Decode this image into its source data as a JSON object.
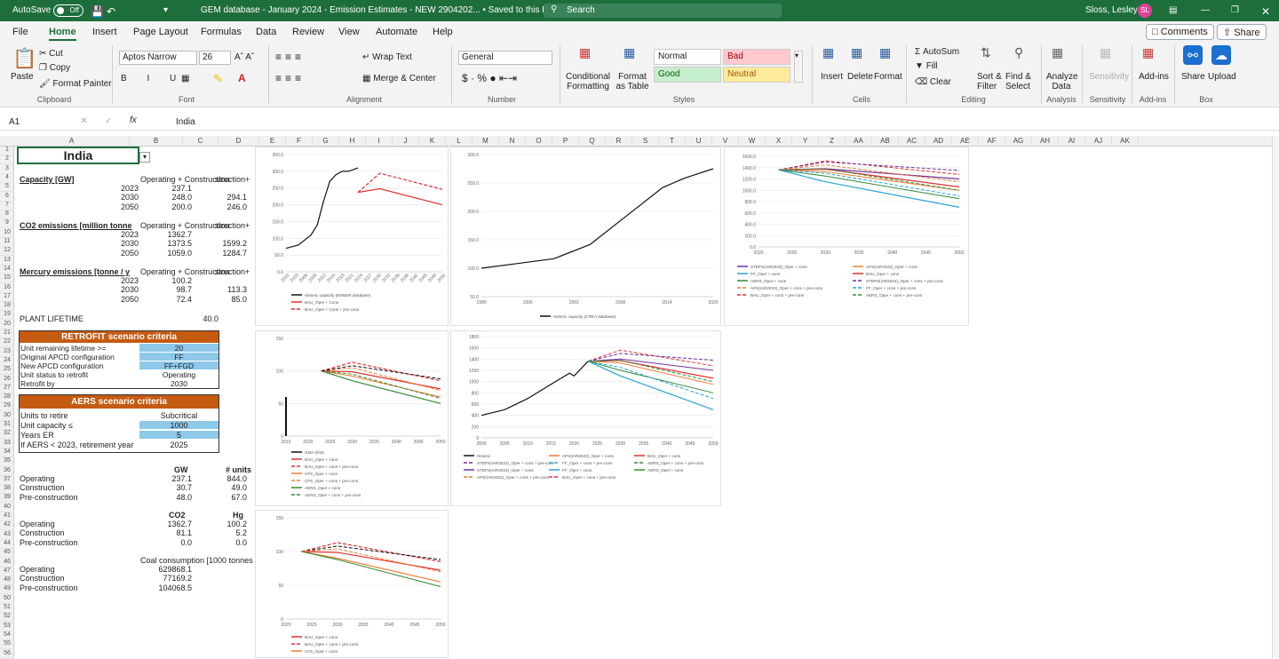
{
  "titlebar": {
    "autosave": "AutoSave",
    "autosave_state": "Off",
    "doc_title": "GEM database - January 2024 - Emission Estimates - NEW 2904202... • Saved to this PC ∨",
    "search": "Search",
    "user": "Sloss, Lesley",
    "user_initials": "SL"
  },
  "menu": {
    "tabs": [
      "File",
      "Home",
      "Insert",
      "Page Layout",
      "Formulas",
      "Data",
      "Review",
      "View",
      "Automate",
      "Help"
    ],
    "comments": "Comments",
    "share": "Share"
  },
  "ribbon": {
    "paste": "Paste",
    "cut": "Cut",
    "copy": "Copy",
    "format_painter": "Format Painter",
    "clipboard": "Clipboard",
    "font_name": "Aptos Narrow",
    "font_size": "26",
    "font_group": "Font",
    "wrap_text": "Wrap Text",
    "merge_center": "Merge & Center",
    "alignment": "Alignment",
    "number_format": "General",
    "number": "Number",
    "conditional_formatting": "Conditional Formatting",
    "format_as_table": "Format as Table",
    "style_normal": "Normal",
    "style_bad": "Bad",
    "style_good": "Good",
    "style_neutral": "Neutral",
    "styles": "Styles",
    "insert": "Insert",
    "delete": "Delete",
    "format": "Format",
    "cells": "Cells",
    "autosum": "AutoSum",
    "fill": "Fill",
    "clear": "Clear",
    "sort_filter": "Sort & Filter",
    "find_select": "Find & Select",
    "editing": "Editing",
    "analyze_data": "Analyze Data",
    "analysis": "Analysis",
    "sensitivity": "Sensitivity",
    "sensitivity_group": "Sensitivity",
    "addins": "Add-ins",
    "addins_group": "Add-ins",
    "share": "Share",
    "upload": "Upload",
    "box": "Box"
  },
  "formula_bar": {
    "name_box": "A1",
    "formula": "India"
  },
  "columns": [
    "A",
    "B",
    "C",
    "D",
    "E",
    "F",
    "G",
    "H",
    "I",
    "J",
    "K",
    "L",
    "M",
    "N",
    "O",
    "P",
    "Q",
    "R",
    "S",
    "T",
    "U",
    "V",
    "W",
    "X",
    "Y",
    "Z",
    "AA",
    "AB",
    "AC",
    "AD",
    "AE",
    "AF",
    "AG",
    "AH",
    "AI",
    "AJ",
    "AK"
  ],
  "sheet": {
    "country": "India",
    "capacity_title": "Capacity [GW]",
    "co2_title": "CO2 emissions [million tonne",
    "hg_title": "Mercury emissions [tonne / y",
    "col_op_con": "Operating + Construction",
    "col_struction": "struction+",
    "col_op_con_pre": "Operating + Construction + Pre-construction",
    "capacity_rows": [
      [
        "2023",
        "237.1",
        ""
      ],
      [
        "2030",
        "248.0",
        "294.1"
      ],
      [
        "2050",
        "200.0",
        "246.0"
      ]
    ],
    "co2_rows": [
      [
        "2023",
        "1362.7",
        ""
      ],
      [
        "2030",
        "1373.5",
        "1599.2"
      ],
      [
        "2050",
        "1059.0",
        "1284.7"
      ]
    ],
    "hg_rows": [
      [
        "2023",
        "100.2",
        ""
      ],
      [
        "2030",
        "98.7",
        "113.3"
      ],
      [
        "2050",
        "72.4",
        "85.0"
      ]
    ],
    "plant_lifetime_label": "PLANT LIFETIME",
    "plant_lifetime": "40.0",
    "retrofit_title": "RETROFIT scenario criteria",
    "retrofit_rows": [
      [
        "Unit remaining lifetime >=",
        "20"
      ],
      [
        "Original APCD configuration",
        "FF"
      ],
      [
        "New APCD configuration",
        "FF+FGD"
      ],
      [
        "Unit status to retrofit",
        "Operating"
      ],
      [
        "Retrofit by",
        "2030"
      ]
    ],
    "aers_title": "AERS scenario criteria",
    "aers_rows": [
      [
        "Units to retire",
        "Subcritical"
      ],
      [
        "Unit capacity ≤",
        "1000"
      ],
      [
        "Years ER",
        "5"
      ],
      [
        "If AERS < 2023, retirement year",
        "2025"
      ]
    ],
    "gw_header": "GW",
    "units_header": "# units",
    "gw_rows": [
      [
        "Operating",
        "237.1",
        "844.0"
      ],
      [
        "Construction",
        "30.7",
        "49.0"
      ],
      [
        "Pre-construction",
        "48.0",
        "67.0"
      ]
    ],
    "co2_header": "CO2",
    "hg_header": "Hg",
    "co2hg_rows": [
      [
        "Operating",
        "1362.7",
        "100.2"
      ],
      [
        "Construction",
        "81.1",
        "5.2"
      ],
      [
        "Pre-construction",
        "0.0",
        "0.0"
      ]
    ],
    "coal_header": "Coal consumption [1000 tonnes / year]",
    "coal_rows": [
      [
        "Operating",
        "629868.1"
      ],
      [
        "Construction",
        "77169.2"
      ],
      [
        "Pre-construction",
        "104068.5"
      ]
    ]
  },
  "charts": {
    "c1_legend": [
      "Historic capacity (EMBER database)",
      "BAU_Oper + Cons",
      "BAU_Oper + Cons + pre-cons"
    ],
    "c2_legend": [
      "Historic capacity (CREA database)"
    ],
    "c3_legend": [
      "STEPS(IAR2023)_Oper + cons",
      "APS(IAR2023)_Oper + cons",
      "FF_Oper + cons",
      "BAU_Oper + cons",
      "AERS_Oper + cons",
      "STEPS(IAR2023)_Oper + cons + pre-cons",
      "APS(IAR2023)_Oper + cons + pre-cons",
      "FF_Oper + cons + pre-cons",
      "BAU_Oper + cons + pre-cons",
      "AERS_Oper + cons + pre-cons"
    ],
    "c4_legend": [
      "GMA 2018",
      "BAU_Oper + cons",
      "BAU_Oper + cons + pre-cons",
      "CFS_Oper + cons",
      "CFS_Oper + cons + pre-cons",
      "AERS_Oper + cons",
      "AERS_Oper + cons + pre-cons"
    ],
    "c5_legend": [
      "Historic",
      "APS(IAR2023)_Oper + cons",
      "BAU_Oper + cons",
      "STEPS(IAR2023)_Oper + cons + pre-cons",
      "FF_Oper + cons + pre-cons",
      "AERS_Oper + cons + pre-cons",
      "STEPS(IAR2023)_Oper + cons",
      "FF_Oper + cons",
      "AERS_Oper + cons",
      "APS(IAR2023)_Oper + cons + pre-cons",
      "BAU_Oper + cons + pre-cons"
    ],
    "c6_legend": [
      "BAU_Oper + cons",
      "BAU_Oper + cons + pre-cons",
      "CFS_Oper + cons"
    ]
  },
  "chart_data": [
    {
      "type": "line",
      "title": "",
      "series": [
        {
          "name": "Historic capacity (EMBER database)",
          "x": [
            2000,
            2004,
            2008,
            2010,
            2012,
            2014,
            2016,
            2018,
            2020,
            2023
          ],
          "values": [
            70,
            80,
            110,
            140,
            210,
            270,
            290,
            300,
            300,
            310
          ]
        },
        {
          "name": "BAU_Oper + Cons",
          "x": [
            2023,
            2030,
            2050
          ],
          "values": [
            237,
            248,
            200
          ]
        },
        {
          "name": "BAU_Oper + Cons + pre-cons",
          "x": [
            2023,
            2030,
            2050
          ],
          "values": [
            237,
            294,
            246
          ]
        }
      ],
      "ylim": [
        0,
        350
      ],
      "ytick_labels": [
        "0.0",
        "50.0",
        "100.0",
        "150.0",
        "200.0",
        "250.0",
        "300.0",
        "350.0"
      ],
      "xtick_labels": [
        "2000",
        "2003",
        "2006",
        "2009",
        "2012",
        "2015",
        "2018",
        "2021",
        "2024",
        "2027",
        "2030",
        "2033",
        "2036",
        "2039",
        "2042",
        "2045",
        "2048",
        "2050"
      ]
    },
    {
      "type": "line",
      "series": [
        {
          "name": "Historic capacity (CREA database)",
          "x": [
            1990,
            1995,
            2000,
            2005,
            2010,
            2015,
            2018,
            2020,
            2022
          ],
          "values": [
            60,
            70,
            80,
            110,
            170,
            230,
            250,
            260,
            270
          ]
        }
      ],
      "ylim": [
        0,
        300
      ],
      "ytick_labels": [
        "50.0",
        "100.0",
        "150.0",
        "200.0",
        "250.0",
        "300.0"
      ],
      "xtick_labels": [
        "1990",
        "1996",
        "2002",
        "2008",
        "2014",
        "2020"
      ]
    },
    {
      "type": "line",
      "series": [
        {
          "name": "STEPS(IAR2023)_Oper + cons",
          "x": [
            2023,
            2030,
            2050
          ],
          "values": [
            1362,
            1380,
            1200
          ]
        },
        {
          "name": "BAU_Oper + cons",
          "x": [
            2023,
            2030,
            2050
          ],
          "values": [
            1362,
            1373,
            1059
          ]
        },
        {
          "name": "FF_Oper + cons",
          "x": [
            2023,
            2030,
            2050
          ],
          "values": [
            1362,
            1150,
            700
          ]
        }
      ],
      "ylim": [
        0,
        1600
      ],
      "ytick_labels": [
        "0.0",
        "200.0",
        "400.0",
        "600.0",
        "800.0",
        "1000.0",
        "1200.0",
        "1400.0",
        "1600.0"
      ],
      "xtick_labels": [
        "2020",
        "2025",
        "2030",
        "2035",
        "2040",
        "2045",
        "2050"
      ]
    },
    {
      "type": "line",
      "series": [
        {
          "name": "GMA 2018",
          "x": [
            2015
          ],
          "values": [
            60
          ]
        },
        {
          "name": "BAU_Oper + cons",
          "x": [
            2023,
            2030,
            2050
          ],
          "values": [
            100,
            98.7,
            72.4
          ]
        },
        {
          "name": "BAU_Oper + cons + pre-cons",
          "x": [
            2023,
            2030,
            2050
          ],
          "values": [
            100,
            113.3,
            85
          ]
        },
        {
          "name": "AERS_Oper + cons",
          "x": [
            2023,
            2030,
            2050
          ],
          "values": [
            100,
            85,
            50
          ]
        }
      ],
      "ylim": [
        0,
        150
      ],
      "ytick_labels": [
        "0",
        "50",
        "100",
        "150"
      ],
      "xtick_labels": [
        "2015",
        "2020",
        "2025",
        "2030",
        "2035",
        "2040",
        "2045",
        "2050"
      ]
    },
    {
      "type": "line",
      "series": [
        {
          "name": "Historic",
          "x": [
            2000,
            2005,
            2010,
            2015,
            2019,
            2020,
            2023
          ],
          "values": [
            400,
            500,
            700,
            950,
            1150,
            1100,
            1362
          ]
        },
        {
          "name": "BAU_Oper + cons",
          "x": [
            2023,
            2030,
            2050
          ],
          "values": [
            1362,
            1373,
            1059
          ]
        },
        {
          "name": "FF_Oper + cons",
          "x": [
            2023,
            2030,
            2050
          ],
          "values": [
            1362,
            1100,
            500
          ]
        }
      ],
      "ylim": [
        0,
        1800
      ],
      "ytick_labels": [
        "0",
        "200",
        "400",
        "600",
        "800",
        "1000",
        "1200",
        "1400",
        "1600",
        "1800"
      ],
      "xtick_labels": [
        "2000",
        "2005",
        "2010",
        "2015",
        "2020",
        "2025",
        "2030",
        "2035",
        "2040",
        "2045",
        "2050"
      ]
    },
    {
      "type": "line",
      "series": [
        {
          "name": "BAU_Oper + cons",
          "x": [
            2023,
            2030,
            2050
          ],
          "values": [
            100,
            98.7,
            72.4
          ]
        },
        {
          "name": "BAU_Oper + cons + pre-cons",
          "x": [
            2023,
            2030,
            2050
          ],
          "values": [
            100,
            113.3,
            85
          ]
        },
        {
          "name": "CFS_Oper + cons",
          "x": [
            2023,
            2030,
            2050
          ],
          "values": [
            100,
            90,
            55
          ]
        }
      ],
      "ylim": [
        0,
        150
      ],
      "ytick_labels": [
        "0",
        "50",
        "100",
        "150"
      ],
      "xtick_labels": [
        "2020",
        "2025",
        "2030",
        "2035",
        "2040",
        "2045",
        "2050"
      ]
    }
  ]
}
